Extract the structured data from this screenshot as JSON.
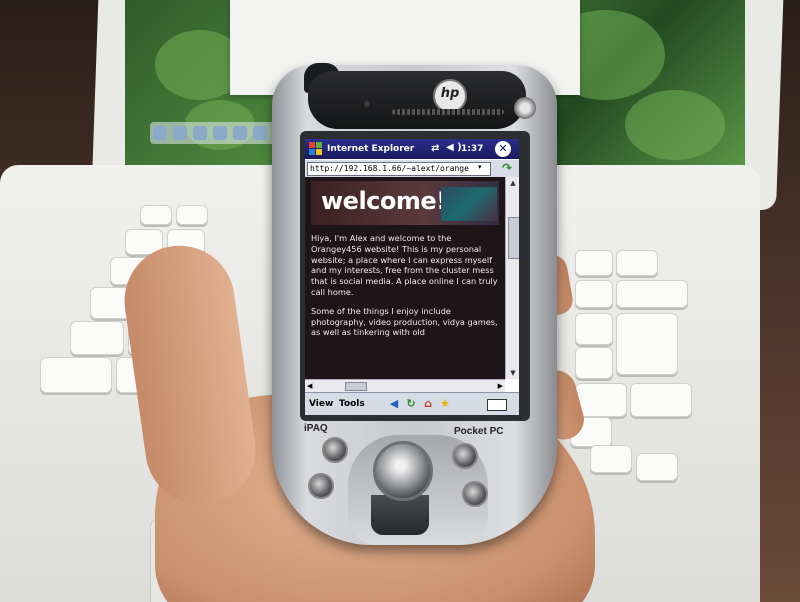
{
  "device": {
    "brand_logo": "hp",
    "model_label": "iPAQ",
    "os_label": "Pocket PC"
  },
  "window": {
    "start_icon": "windows-flag-icon",
    "title": "Internet Explorer",
    "sync_icon": "⇄",
    "volume_icon": "◀€",
    "time": "1:37",
    "close_label": "✕"
  },
  "address_bar": {
    "url": "http://192.168.1.66/~alext/orange",
    "dropdown_glyph": "▾",
    "go_glyph": "↷"
  },
  "page": {
    "heading": "welcome!",
    "paragraphs": [
      "Hiya, I'm Alex and welcome to the Orangey456 website! This is my personal website; a place where I can express myself and my interests, free from the cluster mess that is social media. A place online I can truly call home.",
      "Some of the things I enjoy include photography, video production, vidya games, as well as tinkering with old"
    ]
  },
  "scrollbars": {
    "up": "▲",
    "down": "▼",
    "left": "◀",
    "right": "▶"
  },
  "menubar": {
    "view": "View",
    "tools": "Tools",
    "back_icon": "◀",
    "refresh_icon": "↻",
    "home_icon": "⌂",
    "favorites_icon": "★"
  },
  "colors": {
    "titlebar": "#1f2370",
    "page_bg": "#1f1418",
    "page_text": "#f2e8e6"
  }
}
